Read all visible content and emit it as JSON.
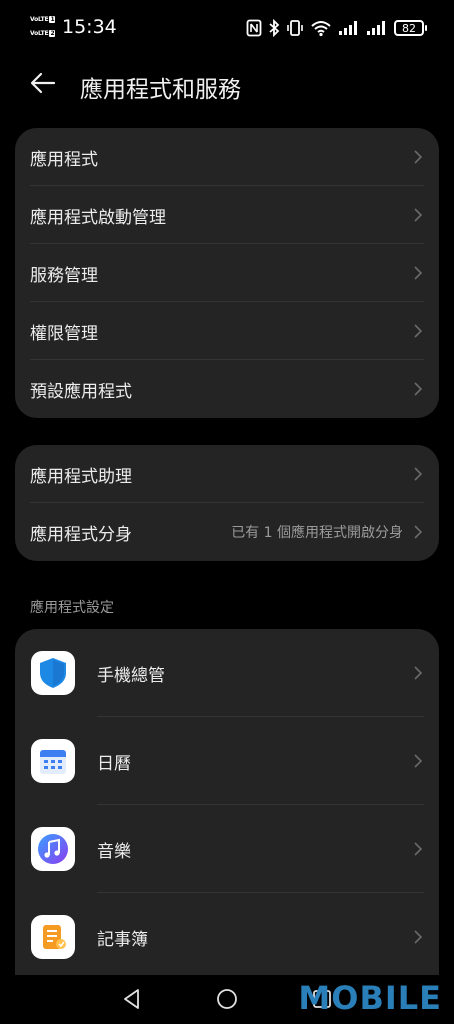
{
  "status_bar": {
    "time": "15:34",
    "sim1_label": "VoLTE",
    "sim1_num": "1",
    "sim2_label": "VoLTE",
    "sim2_num": "2",
    "battery": "82"
  },
  "header": {
    "title": "應用程式和服務"
  },
  "group1": [
    {
      "label": "應用程式"
    },
    {
      "label": "應用程式啟動管理"
    },
    {
      "label": "服務管理"
    },
    {
      "label": "權限管理"
    },
    {
      "label": "預設應用程式"
    }
  ],
  "group2": [
    {
      "label": "應用程式助理",
      "value": ""
    },
    {
      "label": "應用程式分身",
      "value": "已有 1 個應用程式開啟分身"
    }
  ],
  "section_header": "應用程式設定",
  "apps": [
    {
      "label": "手機總管",
      "icon": "shield-icon"
    },
    {
      "label": "日曆",
      "icon": "calendar-icon"
    },
    {
      "label": "音樂",
      "icon": "music-note-icon"
    },
    {
      "label": "記事簿",
      "icon": "notepad-icon"
    }
  ],
  "watermark": "MOBILE",
  "colors": {
    "background": "#000000",
    "card": "#242424",
    "text_primary": "#ececec",
    "text_secondary": "#9a9a9a",
    "shield_blue": "#1e88e5",
    "music_purple": "#5b5fe0",
    "notepad_orange": "#f59a23",
    "watermark_blue": "#2a7fb8"
  }
}
